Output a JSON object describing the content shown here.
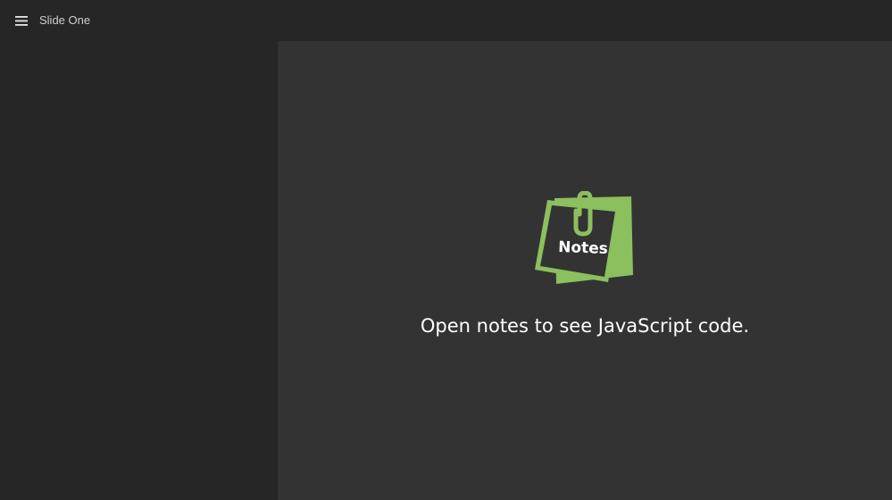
{
  "header": {
    "title": "Slide One",
    "menu_icon": "hamburger-menu-icon"
  },
  "slide": {
    "logo": {
      "icon": "notes-paperclip-icon",
      "label": "Notes",
      "color": "#8cbf5d"
    },
    "message": "Open notes to see JavaScript code."
  },
  "colors": {
    "topbar": "#262626",
    "sidebar": "#262626",
    "stage": "#333333",
    "text": "#ffffff",
    "accent": "#8cbf5d"
  }
}
